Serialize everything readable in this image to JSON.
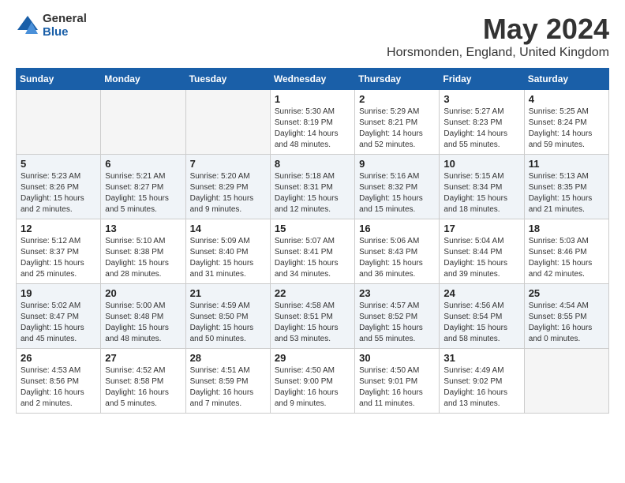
{
  "logo": {
    "general": "General",
    "blue": "Blue"
  },
  "title": "May 2024",
  "subtitle": "Horsmonden, England, United Kingdom",
  "days_of_week": [
    "Sunday",
    "Monday",
    "Tuesday",
    "Wednesday",
    "Thursday",
    "Friday",
    "Saturday"
  ],
  "weeks": [
    [
      {
        "num": "",
        "info": ""
      },
      {
        "num": "",
        "info": ""
      },
      {
        "num": "",
        "info": ""
      },
      {
        "num": "1",
        "info": "Sunrise: 5:30 AM\nSunset: 8:19 PM\nDaylight: 14 hours\nand 48 minutes."
      },
      {
        "num": "2",
        "info": "Sunrise: 5:29 AM\nSunset: 8:21 PM\nDaylight: 14 hours\nand 52 minutes."
      },
      {
        "num": "3",
        "info": "Sunrise: 5:27 AM\nSunset: 8:23 PM\nDaylight: 14 hours\nand 55 minutes."
      },
      {
        "num": "4",
        "info": "Sunrise: 5:25 AM\nSunset: 8:24 PM\nDaylight: 14 hours\nand 59 minutes."
      }
    ],
    [
      {
        "num": "5",
        "info": "Sunrise: 5:23 AM\nSunset: 8:26 PM\nDaylight: 15 hours\nand 2 minutes."
      },
      {
        "num": "6",
        "info": "Sunrise: 5:21 AM\nSunset: 8:27 PM\nDaylight: 15 hours\nand 5 minutes."
      },
      {
        "num": "7",
        "info": "Sunrise: 5:20 AM\nSunset: 8:29 PM\nDaylight: 15 hours\nand 9 minutes."
      },
      {
        "num": "8",
        "info": "Sunrise: 5:18 AM\nSunset: 8:31 PM\nDaylight: 15 hours\nand 12 minutes."
      },
      {
        "num": "9",
        "info": "Sunrise: 5:16 AM\nSunset: 8:32 PM\nDaylight: 15 hours\nand 15 minutes."
      },
      {
        "num": "10",
        "info": "Sunrise: 5:15 AM\nSunset: 8:34 PM\nDaylight: 15 hours\nand 18 minutes."
      },
      {
        "num": "11",
        "info": "Sunrise: 5:13 AM\nSunset: 8:35 PM\nDaylight: 15 hours\nand 21 minutes."
      }
    ],
    [
      {
        "num": "12",
        "info": "Sunrise: 5:12 AM\nSunset: 8:37 PM\nDaylight: 15 hours\nand 25 minutes."
      },
      {
        "num": "13",
        "info": "Sunrise: 5:10 AM\nSunset: 8:38 PM\nDaylight: 15 hours\nand 28 minutes."
      },
      {
        "num": "14",
        "info": "Sunrise: 5:09 AM\nSunset: 8:40 PM\nDaylight: 15 hours\nand 31 minutes."
      },
      {
        "num": "15",
        "info": "Sunrise: 5:07 AM\nSunset: 8:41 PM\nDaylight: 15 hours\nand 34 minutes."
      },
      {
        "num": "16",
        "info": "Sunrise: 5:06 AM\nSunset: 8:43 PM\nDaylight: 15 hours\nand 36 minutes."
      },
      {
        "num": "17",
        "info": "Sunrise: 5:04 AM\nSunset: 8:44 PM\nDaylight: 15 hours\nand 39 minutes."
      },
      {
        "num": "18",
        "info": "Sunrise: 5:03 AM\nSunset: 8:46 PM\nDaylight: 15 hours\nand 42 minutes."
      }
    ],
    [
      {
        "num": "19",
        "info": "Sunrise: 5:02 AM\nSunset: 8:47 PM\nDaylight: 15 hours\nand 45 minutes."
      },
      {
        "num": "20",
        "info": "Sunrise: 5:00 AM\nSunset: 8:48 PM\nDaylight: 15 hours\nand 48 minutes."
      },
      {
        "num": "21",
        "info": "Sunrise: 4:59 AM\nSunset: 8:50 PM\nDaylight: 15 hours\nand 50 minutes."
      },
      {
        "num": "22",
        "info": "Sunrise: 4:58 AM\nSunset: 8:51 PM\nDaylight: 15 hours\nand 53 minutes."
      },
      {
        "num": "23",
        "info": "Sunrise: 4:57 AM\nSunset: 8:52 PM\nDaylight: 15 hours\nand 55 minutes."
      },
      {
        "num": "24",
        "info": "Sunrise: 4:56 AM\nSunset: 8:54 PM\nDaylight: 15 hours\nand 58 minutes."
      },
      {
        "num": "25",
        "info": "Sunrise: 4:54 AM\nSunset: 8:55 PM\nDaylight: 16 hours\nand 0 minutes."
      }
    ],
    [
      {
        "num": "26",
        "info": "Sunrise: 4:53 AM\nSunset: 8:56 PM\nDaylight: 16 hours\nand 2 minutes."
      },
      {
        "num": "27",
        "info": "Sunrise: 4:52 AM\nSunset: 8:58 PM\nDaylight: 16 hours\nand 5 minutes."
      },
      {
        "num": "28",
        "info": "Sunrise: 4:51 AM\nSunset: 8:59 PM\nDaylight: 16 hours\nand 7 minutes."
      },
      {
        "num": "29",
        "info": "Sunrise: 4:50 AM\nSunset: 9:00 PM\nDaylight: 16 hours\nand 9 minutes."
      },
      {
        "num": "30",
        "info": "Sunrise: 4:50 AM\nSunset: 9:01 PM\nDaylight: 16 hours\nand 11 minutes."
      },
      {
        "num": "31",
        "info": "Sunrise: 4:49 AM\nSunset: 9:02 PM\nDaylight: 16 hours\nand 13 minutes."
      },
      {
        "num": "",
        "info": ""
      }
    ]
  ]
}
